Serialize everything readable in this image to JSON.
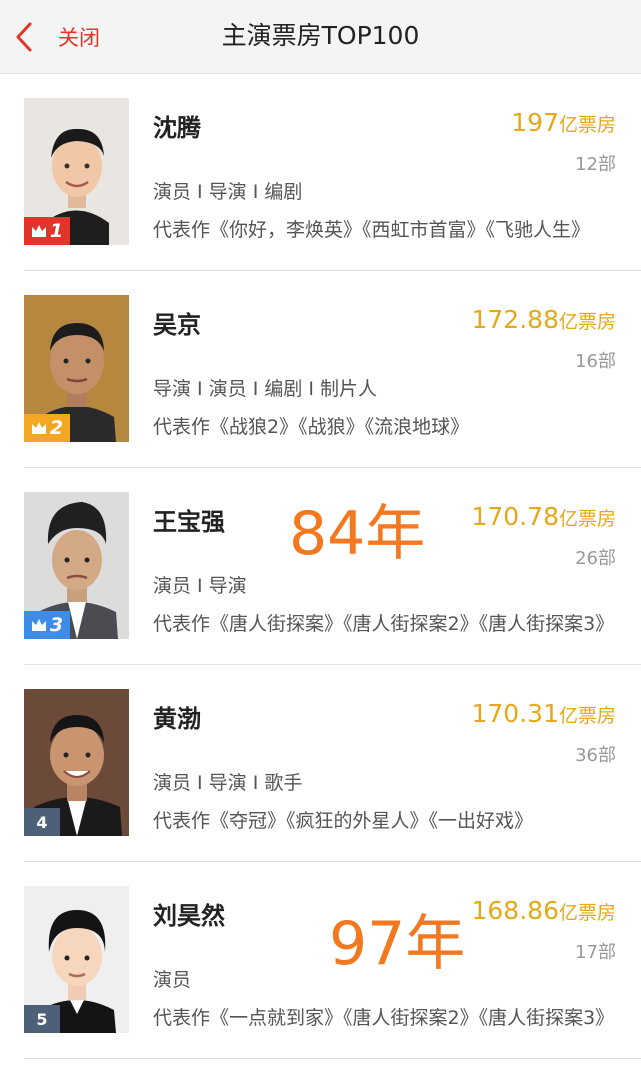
{
  "header": {
    "back_label": "关闭",
    "title": "主演票房TOP100"
  },
  "colors": {
    "accent": "#e0352b",
    "boxoffice": "#e6a817",
    "rank1": "#e0352b",
    "rank2": "#f3a722",
    "rank3": "#3d8de8",
    "rank_plain": "#4e6078",
    "overlay": "#f3781f"
  },
  "actors": [
    {
      "rank": "1",
      "name": "沈腾",
      "boxoffice": "197",
      "unit": "亿票房",
      "count": "12部",
      "roles": "演员 I 导演 I 编剧",
      "works": "代表作《你好，李焕英》《西虹市首富》《飞驰人生》"
    },
    {
      "rank": "2",
      "name": "吴京",
      "boxoffice": "172.88",
      "unit": "亿票房",
      "count": "16部",
      "roles": "导演 I 演员 I 编剧 I 制片人",
      "works": "代表作《战狼2》《战狼》《流浪地球》"
    },
    {
      "rank": "3",
      "name": "王宝强",
      "boxoffice": "170.78",
      "unit": "亿票房",
      "count": "26部",
      "roles": "演员 I 导演",
      "works": "代表作《唐人街探案》《唐人街探案2》《唐人街探案3》",
      "overlay": "84年"
    },
    {
      "rank": "4",
      "name": "黄渤",
      "boxoffice": "170.31",
      "unit": "亿票房",
      "count": "36部",
      "roles": "演员 I 导演 I 歌手",
      "works": "代表作《夺冠》《疯狂的外星人》《一出好戏》"
    },
    {
      "rank": "5",
      "name": "刘昊然",
      "boxoffice": "168.86",
      "unit": "亿票房",
      "count": "17部",
      "roles": "演员",
      "works": "代表作《一点就到家》《唐人街探案2》《唐人街探案3》",
      "overlay": "97年"
    }
  ]
}
